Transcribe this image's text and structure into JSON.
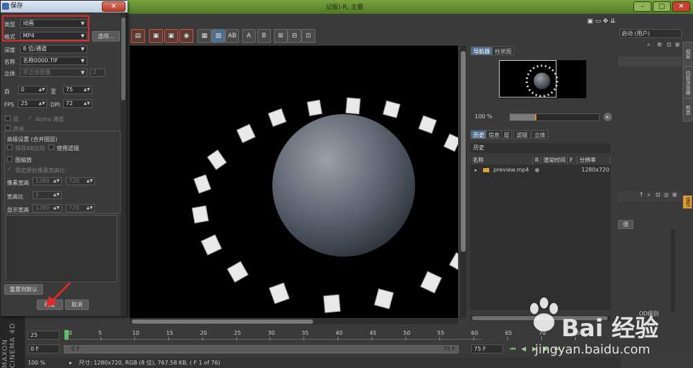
{
  "app": {
    "title_fragment": "记版)·R, 主要",
    "layout_label": "启动 (用户)"
  },
  "dialog": {
    "title": "保存",
    "close_glyph": "✕",
    "type_label": "类型",
    "type_value": "动画",
    "format_label": "格式",
    "format_value": "MP4",
    "options_button": "选项...",
    "depth_label": "深度",
    "depth_value": "8 位/通道",
    "name_label": "名称",
    "name_value": "名称0000.TIF",
    "stereo_label": "立体",
    "stereo_value": "非立体图像",
    "stereo_num": "2",
    "frames_label": "自",
    "from_value": "0",
    "to_label": "至",
    "to_value": "75",
    "fps_label": "FPS",
    "fps_value": "25",
    "dpi_label": "DPI",
    "dpi_value": "72",
    "layers_label": "层",
    "alpha_label": "Alpha 通道",
    "sound_label": "声音",
    "advanced_label": "高级设置 (合并图层)",
    "save_ab_label": "保存AB比较",
    "use_filter_label": "使用滤镜",
    "scale_label": "图缩放",
    "lock_ratio_label": "锁定原始像素宽高比",
    "pixel_res_label": "像素宽高",
    "pixel_w": "1280",
    "pixel_h": "720",
    "aspect_label": "宽高比",
    "aspect_value": "1",
    "display_res_label": "显示宽高",
    "display_w": "1280",
    "display_h": "720",
    "reset_button": "重置到默认",
    "ok_button": "确定",
    "cancel_button": "取消"
  },
  "navigator": {
    "tab_navigator": "导航器",
    "tab_histogram": "柱状图",
    "zoom_value": "100 %",
    "zoom_fraction": 0.3
  },
  "history": {
    "tabs": [
      "历史",
      "信息",
      "层",
      "滤镜",
      "立体"
    ],
    "title": "历史",
    "columns": [
      "名称",
      "R",
      "渲染时间",
      "F",
      "分辨率"
    ],
    "rows": [
      {
        "name": "preview.mp4",
        "resolution": "1280x720"
      }
    ]
  },
  "side_tabs": [
    "视窗",
    "内容浏览器",
    "构造",
    "属性"
  ],
  "timeline": {
    "current_frame": "25",
    "start_field": "0 F",
    "end_field": "75 F",
    "range_start": "0 F",
    "range_end": "75 F",
    "range_end2": "75 F",
    "ticks": [
      "0",
      "5",
      "10",
      "15",
      "20",
      "25",
      "30",
      "35",
      "40",
      "45",
      "50",
      "55",
      "60",
      "65",
      "70",
      "75"
    ]
  },
  "status": {
    "zoom": "100 %",
    "info": "尺寸: 1280x720, RGB (8 位), 767.58 KB, ( F 1 of 76)"
  },
  "side_misc": {
    "attr_value_label": "值",
    "lod_label": "OD级别"
  },
  "branding": {
    "maxon": "MAXON CINEMA 4D",
    "watermark_main": "Bai 经验",
    "watermark_url": "jingyan.baidu.com"
  }
}
